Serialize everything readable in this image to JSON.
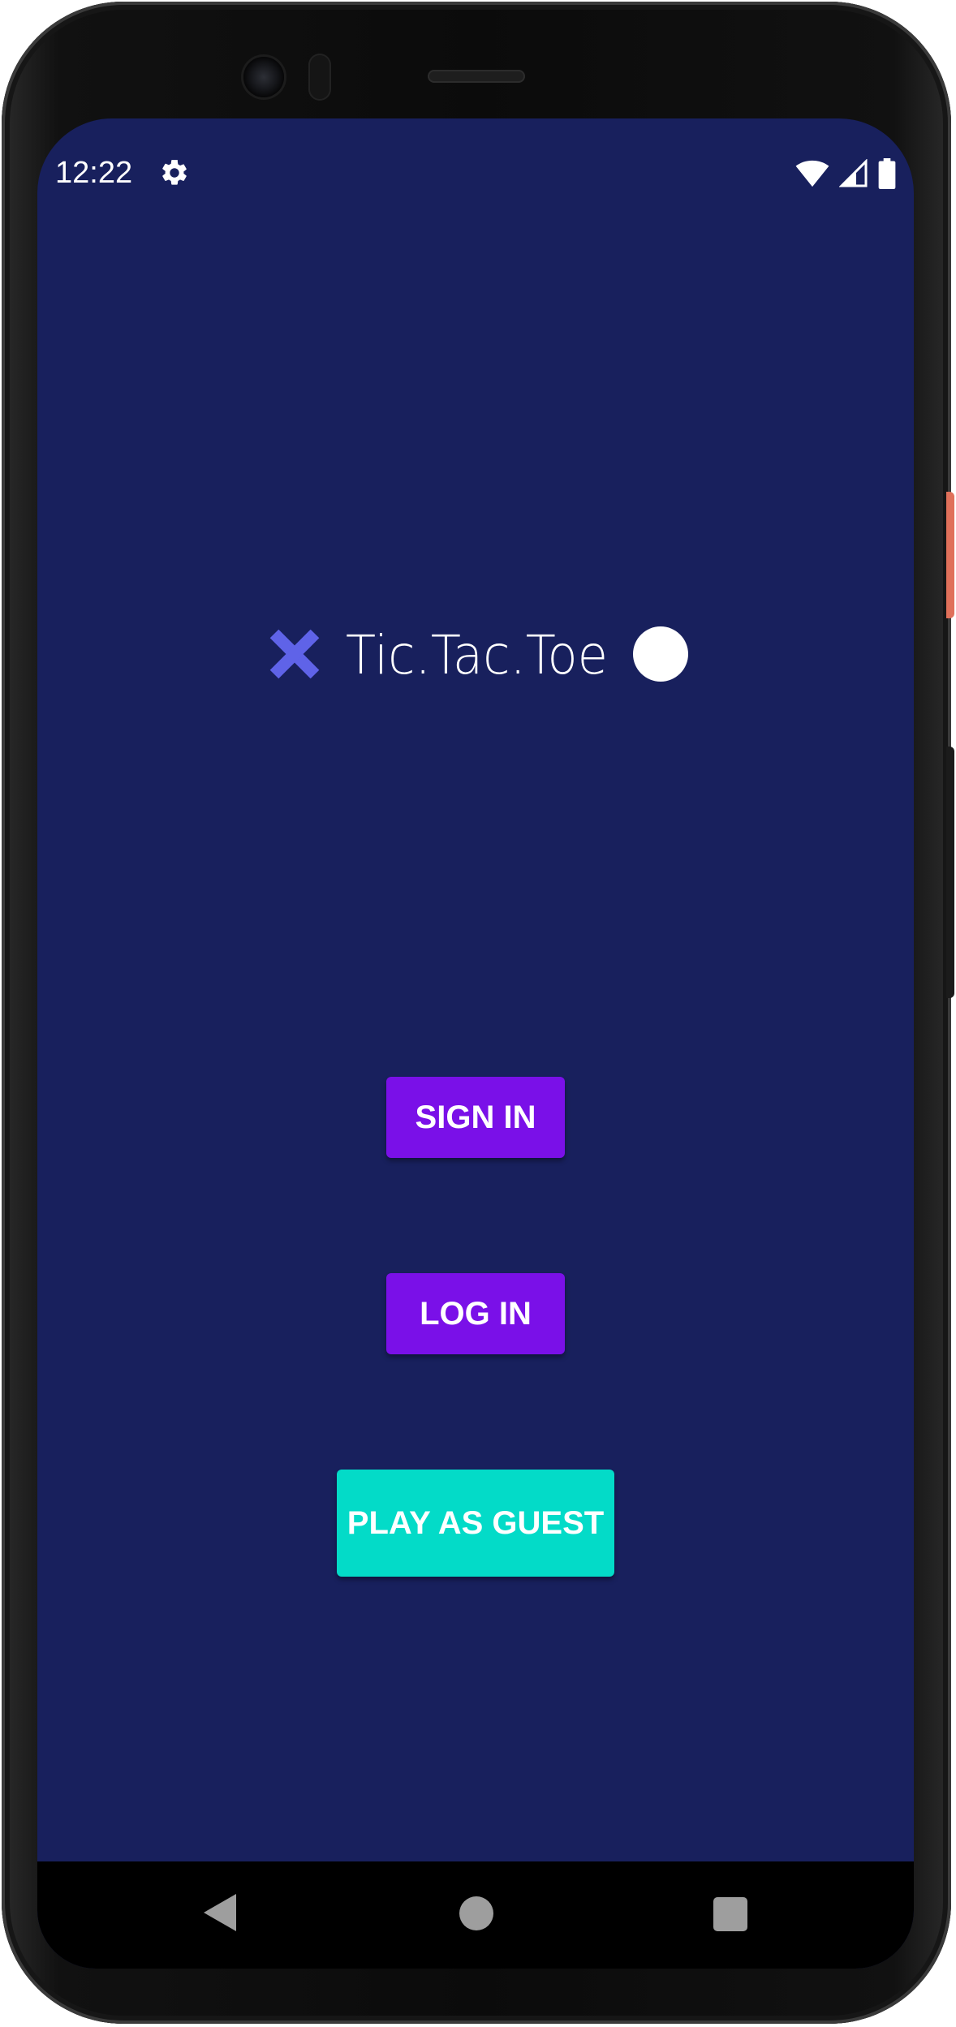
{
  "status_bar": {
    "time": "12:22",
    "icons": [
      "gear-icon",
      "wifi-icon",
      "cellular-signal-icon",
      "battery-icon"
    ]
  },
  "app": {
    "title": "Tic.Tac.Toe",
    "logo_icons": [
      "x-mark-icon",
      "o-circle-icon"
    ]
  },
  "buttons": {
    "sign_in": "SIGN IN",
    "log_in": "LOG IN",
    "play_as_guest": "PLAY AS GUEST"
  },
  "nav_bar": {
    "icons": [
      "back-icon",
      "home-icon",
      "recents-icon"
    ]
  },
  "colors": {
    "background": "#18205d",
    "primary_button": "#7a10e8",
    "guest_button": "#03dbc8",
    "x_mark": "#5f63e8",
    "o_mark": "#ffffff"
  }
}
